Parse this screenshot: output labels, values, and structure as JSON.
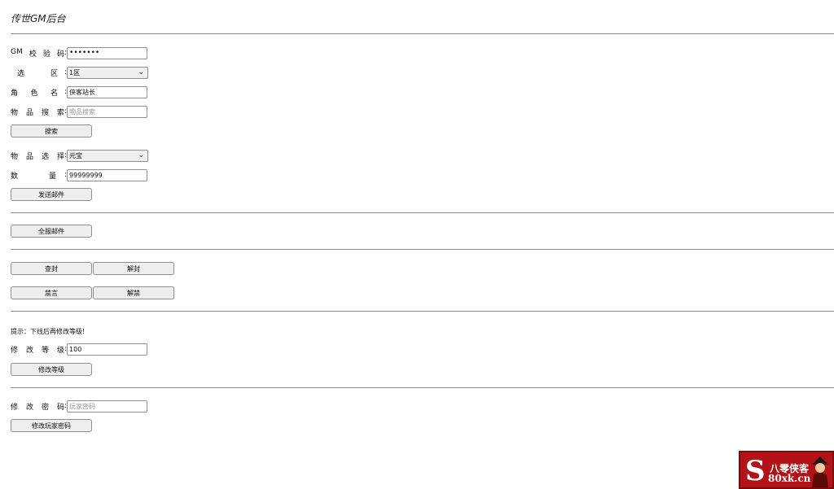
{
  "page": {
    "title": "传世GM后台"
  },
  "gm_code": {
    "label": [
      "GM",
      "校",
      "验",
      "码"
    ],
    "value": "•••••••"
  },
  "zone": {
    "label": [
      "选",
      "区"
    ],
    "selected": "1区"
  },
  "role": {
    "label": [
      "角",
      "色",
      "名"
    ],
    "value": "侠客站长"
  },
  "item_search": {
    "label": [
      "物",
      "品",
      "搜",
      "索"
    ],
    "placeholder": "物品搜索"
  },
  "search_button": "搜索",
  "item_select": {
    "label": [
      "物",
      "品",
      "选",
      "择"
    ],
    "selected": "元宝"
  },
  "quantity": {
    "label": [
      "数",
      "量"
    ],
    "value": "99999999"
  },
  "send_mail_button": "发送邮件",
  "server_mail_button": "全服邮件",
  "ban_button": "查封",
  "unban_button": "解封",
  "mute_button": "禁言",
  "unmute_button": "解禁",
  "hint": "提示：下线后再修改等级!",
  "level": {
    "label": [
      "修",
      "改",
      "等",
      "级"
    ],
    "value": "100"
  },
  "level_button": "修改等级",
  "password": {
    "label": [
      "修",
      "改",
      "密",
      "码"
    ],
    "placeholder": "玩家密码"
  },
  "password_button": "修改玩家密码",
  "watermark": {
    "line1": "八零侠客",
    "line2": "80xk.cn",
    "letter": "S",
    "color": "#b31216"
  }
}
